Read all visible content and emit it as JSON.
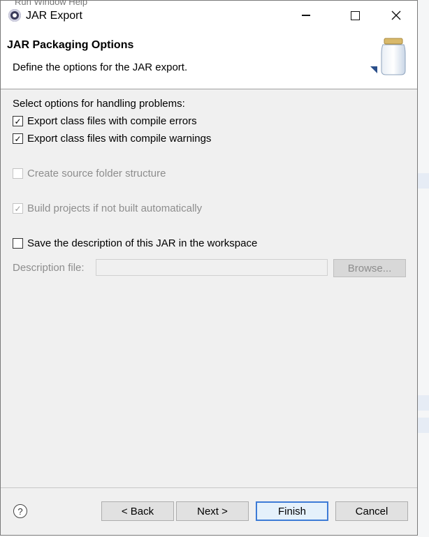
{
  "background": {
    "menu_text": "Run   Window   Help"
  },
  "window": {
    "title": "JAR Export",
    "icon": "eclipse-icon",
    "controls": [
      "minimize-icon",
      "maximize-icon",
      "close-icon"
    ]
  },
  "header": {
    "title": "JAR Packaging Options",
    "description": "Define the options for the JAR export.",
    "icon": "jar-icon"
  },
  "options": {
    "section_label": "Select options for handling problems:",
    "export_errors": {
      "label": "Export class files with compile errors",
      "checked": true,
      "enabled": true
    },
    "export_warnings": {
      "label": "Export class files with compile warnings",
      "checked": true,
      "enabled": true
    },
    "source_folder": {
      "label": "Create source folder structure",
      "checked": false,
      "enabled": false
    },
    "build_projects": {
      "label": "Build projects if not built automatically",
      "checked": true,
      "enabled": false
    },
    "save_description": {
      "label": "Save the description of this JAR in the workspace",
      "checked": false,
      "enabled": true
    }
  },
  "description_file": {
    "label": "Description file:",
    "value": "",
    "browse_label": "Browse..."
  },
  "footer": {
    "help_icon": "help-icon",
    "help_glyph": "?",
    "back_label": "< Back",
    "next_label": "Next >",
    "finish_label": "Finish",
    "cancel_label": "Cancel"
  },
  "colors": {
    "dialog_bg": "#f0f0f0",
    "header_bg": "#ffffff",
    "default_button_border": "#3d7bd6",
    "disabled_text": "#8d8d8d"
  }
}
